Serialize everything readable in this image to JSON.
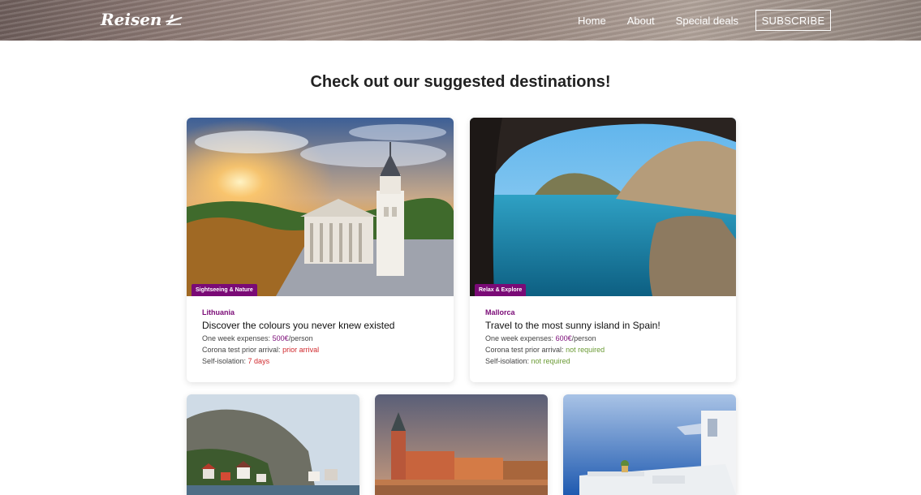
{
  "header": {
    "logo_text": "Reisen",
    "nav": [
      "Home",
      "About",
      "Special deals"
    ],
    "subscribe_label": "SUBSCRIBE"
  },
  "page_title": "Check out our suggested destinations!",
  "cards": [
    {
      "tag": "Sightseeing & Nature",
      "place": "Lithuania",
      "headline": "Discover the colours you never knew existed",
      "expenses_label": "One week expenses:",
      "expenses_value": "500€",
      "expenses_suffix": "/person",
      "corona_label": "Corona test prior arrival:",
      "corona_value": "prior arrival",
      "isolation_label": "Self-isolation:",
      "isolation_value": "7 days"
    },
    {
      "tag": "Relax & Explore",
      "place": "Mallorca",
      "headline": "Travel to the most sunny island in Spain!",
      "expenses_label": "One week expenses:",
      "expenses_value": "600€",
      "expenses_suffix": "/person",
      "corona_label": "Corona test prior arrival:",
      "corona_value": "not required",
      "isolation_label": "Self-isolation:",
      "isolation_value": "not required"
    }
  ],
  "colors": {
    "accent": "#7a0a76",
    "warning": "#d0282c",
    "success": "#6a9a34"
  }
}
